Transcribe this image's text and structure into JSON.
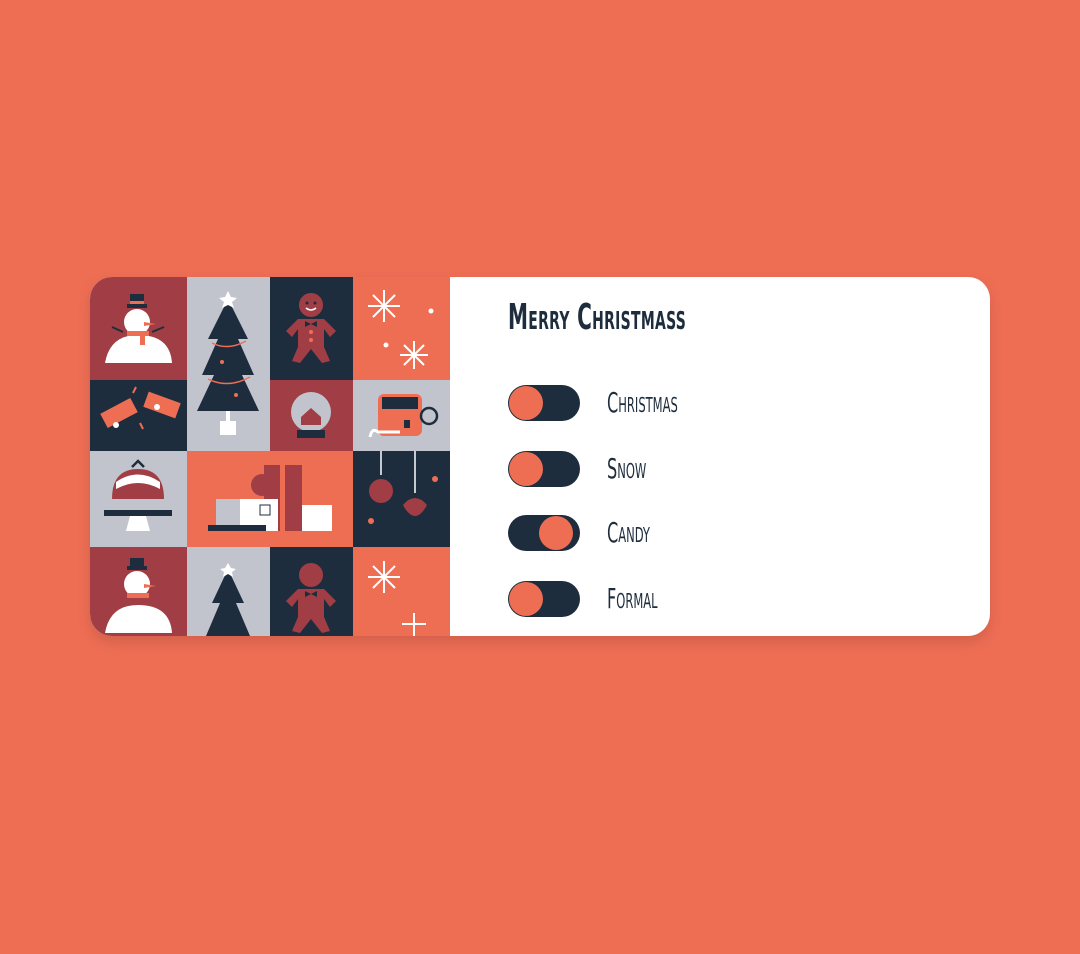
{
  "card": {
    "title": "Merry Christmass",
    "options": [
      {
        "label": "Christmas",
        "on": false
      },
      {
        "label": "Snow",
        "on": false
      },
      {
        "label": "Candy",
        "on": true
      },
      {
        "label": "Formal",
        "on": false
      }
    ]
  },
  "colors": {
    "background": "#ee6e54",
    "navy": "#1e2d3d",
    "maroon": "#a13e45",
    "gray": "#c2c4cd",
    "coral": "#ee6e54",
    "card": "#ffffff"
  },
  "illustrations": [
    "snowman-icon",
    "christmas-tree-icon",
    "gingerbread-man-icon",
    "snowflake-icon",
    "cracker-icon",
    "snow-globe-icon",
    "mug-icon",
    "pudding-icon",
    "gifts-icon",
    "ornaments-icon"
  ]
}
